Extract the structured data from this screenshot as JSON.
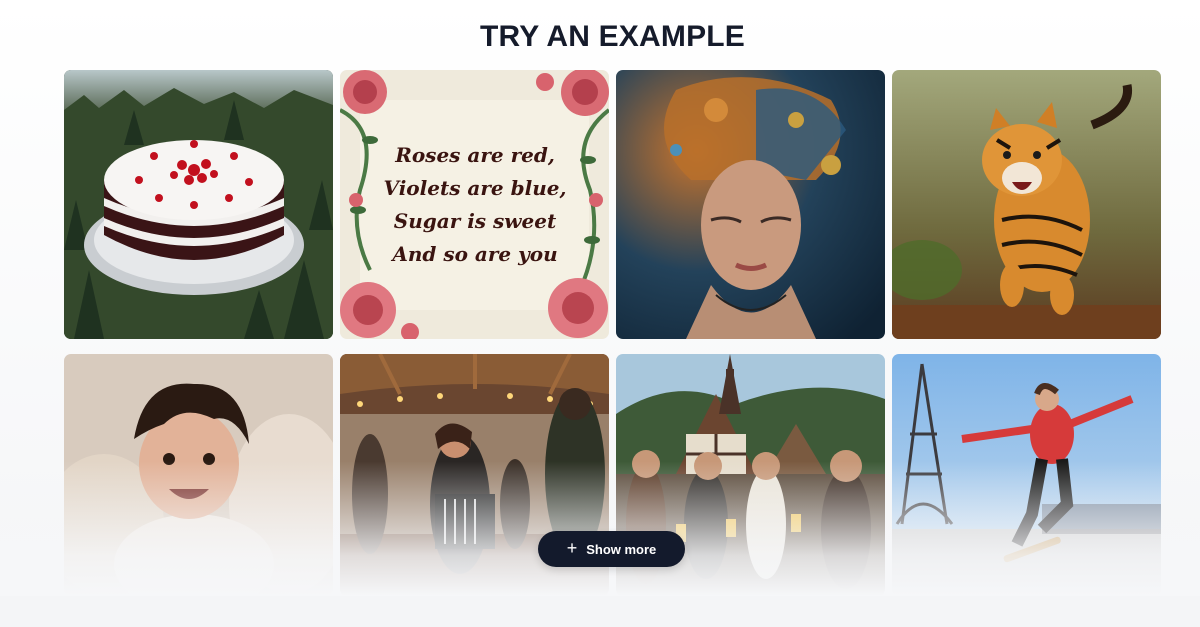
{
  "heading": "TRY AN EXAMPLE",
  "show_more_label": "Show more",
  "examples": [
    {
      "subject": "black-forest-cake"
    },
    {
      "subject": "rose-poem-card",
      "poem_lines": [
        "Roses are red,",
        "Violets are blue,",
        "Sugar is sweet",
        "And so are you"
      ]
    },
    {
      "subject": "surreal-face-portrait"
    },
    {
      "subject": "running-tiger"
    },
    {
      "subject": "smiling-baby"
    },
    {
      "subject": "accordion-dance-party"
    },
    {
      "subject": "village-beer-celebration"
    },
    {
      "subject": "eiffel-skateboarder"
    }
  ],
  "colors": {
    "heading": "#151b2b",
    "button_bg": "#131a2c",
    "button_text": "#ffffff"
  }
}
